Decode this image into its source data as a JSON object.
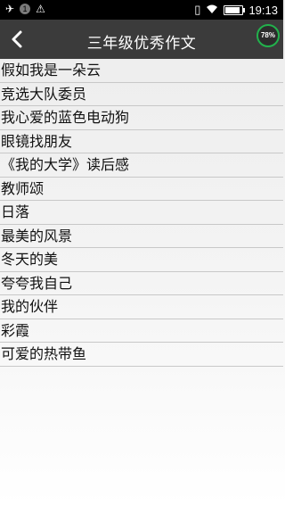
{
  "status_bar": {
    "left_icons": [
      "airplane-icon",
      "notification-count",
      "warning-icon"
    ],
    "notification_count": "1",
    "right_icons": [
      "vibrate-icon",
      "wifi-icon",
      "battery-icon"
    ],
    "battery_level": 0.85,
    "time": "19:13"
  },
  "header": {
    "back_icon": "chevron-left-icon",
    "title": "三年级优秀作文",
    "badge_text": "78%",
    "badge_color": "#22b14c"
  },
  "list": {
    "items": [
      "假如我是一朵云",
      "竞选大队委员",
      "我心爱的蓝色电动狗",
      "眼镜找朋友",
      "《我的大学》读后感",
      "教师颂",
      "日落",
      "最美的风景",
      "冬天的美",
      "夸夸我自己",
      "我的伙伴",
      "彩霞",
      "可爱的热带鱼"
    ]
  }
}
